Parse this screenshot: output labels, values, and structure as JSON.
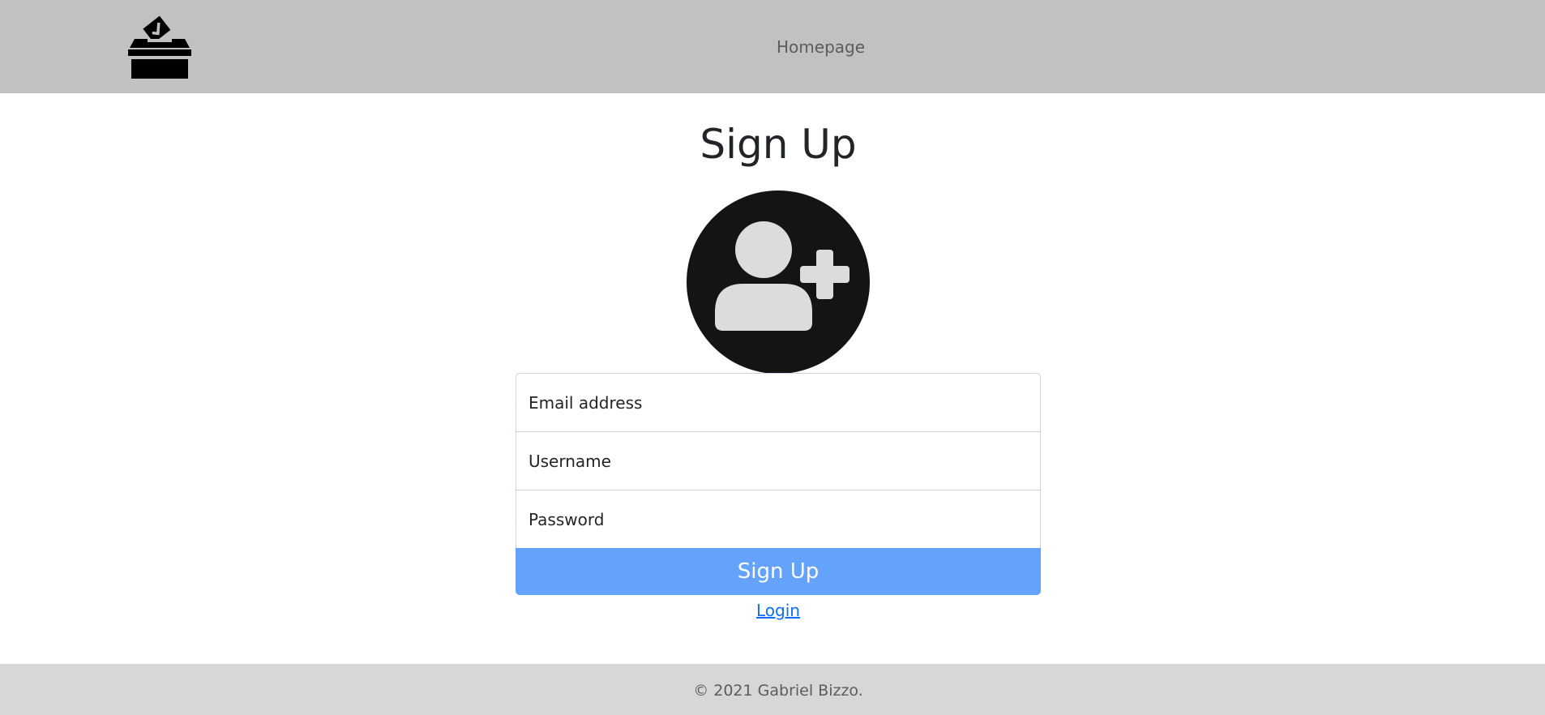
{
  "header": {
    "logo_icon": "ballot-box-icon",
    "nav_homepage": "Homepage"
  },
  "main": {
    "title": "Sign Up",
    "avatar_icon": "add-user-icon",
    "email_placeholder": "Email address",
    "username_placeholder": "Username",
    "password_placeholder": "Password",
    "submit_label": "Sign Up",
    "login_link": "Login"
  },
  "footer": {
    "copyright": "© 2021 Gabriel Bizzo."
  },
  "colors": {
    "navbar_bg": "#c1c1c1",
    "footer_bg": "#d7d7d7",
    "button_bg": "#64a2fb",
    "link": "#0d6efd",
    "avatar_bg": "#141414",
    "avatar_figure": "#dcdcdc"
  }
}
